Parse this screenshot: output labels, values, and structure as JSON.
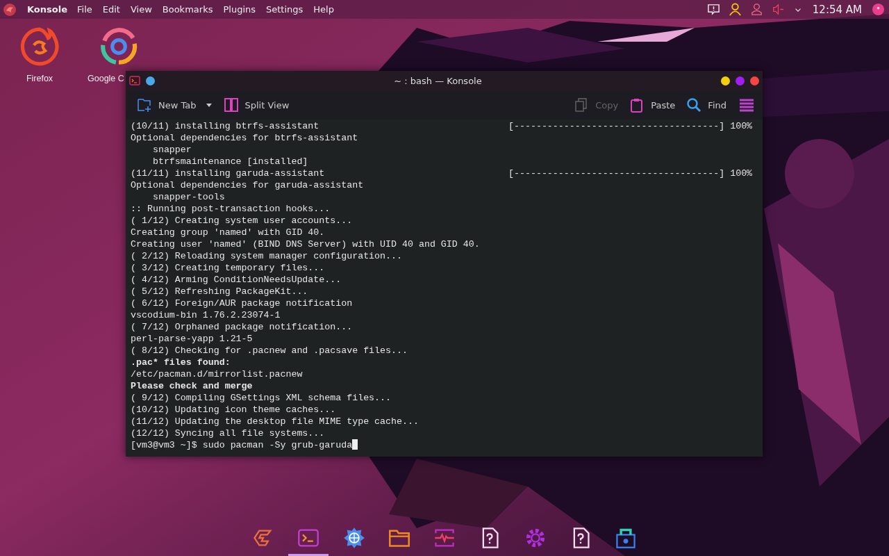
{
  "top_bar": {
    "app_name": "Konsole",
    "menu": [
      "File",
      "Edit",
      "View",
      "Bookmarks",
      "Plugins",
      "Settings",
      "Help"
    ],
    "clock": "12:54 AM"
  },
  "desktop_icons": [
    {
      "label": "Firefox",
      "kind": "firefox"
    },
    {
      "label": "Google C",
      "kind": "chrome"
    }
  ],
  "window": {
    "title": "~ : bash — Konsole"
  },
  "toolbar": [
    {
      "label": "New Tab",
      "kind": "newtab",
      "disabled": false
    },
    {
      "label": "Split View",
      "kind": "split",
      "disabled": false
    },
    {
      "label": "Copy",
      "kind": "copy",
      "disabled": true
    },
    {
      "label": "Paste",
      "kind": "paste",
      "disabled": false
    },
    {
      "label": "Find",
      "kind": "find",
      "disabled": false
    }
  ],
  "terminal": {
    "lines": [
      {
        "text": "(10/11) installing btrfs-assistant",
        "right": "[-------------------------------------] 100%",
        "bold": false
      },
      {
        "text": "Optional dependencies for btrfs-assistant",
        "bold": false
      },
      {
        "text": "    snapper",
        "bold": false
      },
      {
        "text": "    btrfsmaintenance [installed]",
        "bold": false
      },
      {
        "text": "(11/11) installing garuda-assistant",
        "right": "[-------------------------------------] 100%",
        "bold": false
      },
      {
        "text": "Optional dependencies for garuda-assistant",
        "bold": false
      },
      {
        "text": "    snapper-tools",
        "bold": false
      },
      {
        "text": ":: Running post-transaction hooks...",
        "bold": false
      },
      {
        "text": "( 1/12) Creating system user accounts...",
        "bold": false
      },
      {
        "text": "Creating group 'named' with GID 40.",
        "bold": false
      },
      {
        "text": "Creating user 'named' (BIND DNS Server) with UID 40 and GID 40.",
        "bold": false
      },
      {
        "text": "( 2/12) Reloading system manager configuration...",
        "bold": false
      },
      {
        "text": "( 3/12) Creating temporary files...",
        "bold": false
      },
      {
        "text": "( 4/12) Arming ConditionNeedsUpdate...",
        "bold": false
      },
      {
        "text": "( 5/12) Refreshing PackageKit...",
        "bold": false
      },
      {
        "text": "( 6/12) Foreign/AUR package notification",
        "bold": false
      },
      {
        "text": "vscodium-bin 1.76.2.23074-1",
        "bold": false
      },
      {
        "text": "( 7/12) Orphaned package notification...",
        "bold": false
      },
      {
        "text": "perl-parse-yapp 1.21-5",
        "bold": false
      },
      {
        "text": "( 8/12) Checking for .pacnew and .pacsave files...",
        "bold": false
      },
      {
        "text": ".pac* files found:",
        "bold": true
      },
      {
        "text": "/etc/pacman.d/mirrorlist.pacnew",
        "bold": false
      },
      {
        "text": "Please check and merge",
        "bold": true
      },
      {
        "text": "( 9/12) Compiling GSettings XML schema files...",
        "bold": false
      },
      {
        "text": "(10/12) Updating icon theme caches...",
        "bold": false
      },
      {
        "text": "(11/12) Updating the desktop file MIME type cache...",
        "bold": false
      },
      {
        "text": "(12/12) Syncing all file systems...",
        "bold": false
      }
    ],
    "prompt": "[vm3@vm3 ~]$ sudo pacman -Sy grub-garuda"
  },
  "dock": [
    {
      "kind": "garuda",
      "selected": false
    },
    {
      "kind": "terminal",
      "selected": true
    },
    {
      "kind": "globe",
      "selected": false
    },
    {
      "kind": "folder",
      "selected": false
    },
    {
      "kind": "monitor",
      "selected": false
    },
    {
      "kind": "unknown",
      "selected": false
    },
    {
      "kind": "gear",
      "selected": false
    },
    {
      "kind": "unknown",
      "selected": false
    },
    {
      "kind": "store",
      "selected": false
    }
  ]
}
